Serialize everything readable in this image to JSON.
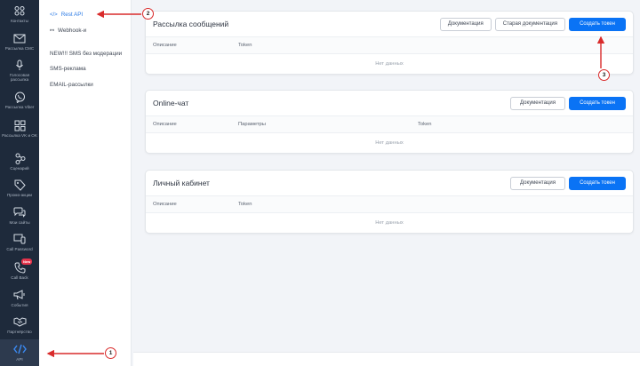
{
  "rail": {
    "items": [
      {
        "label": "Контакты",
        "icon": "contacts-icon"
      },
      {
        "label": "Рассылка СМС",
        "icon": "mail-icon"
      },
      {
        "label": "Голосовая рассылка",
        "icon": "microphone-icon"
      },
      {
        "label": "Рассылка Viber",
        "icon": "viber-icon"
      },
      {
        "label": "Рассылка VK и OK",
        "icon": "grid-icon"
      },
      {
        "label": "Сценарий",
        "icon": "scenario-icon"
      },
      {
        "label": "Промо-акции",
        "icon": "tag-icon"
      },
      {
        "label": "Мои сайты",
        "icon": "chat-icon"
      },
      {
        "label": "Call Password",
        "icon": "phone-screen-icon"
      },
      {
        "label": "Call Back",
        "icon": "callback-icon",
        "badge": "New"
      },
      {
        "label": "События",
        "icon": "megaphone-icon"
      },
      {
        "label": "Партнёрство",
        "icon": "handshake-icon"
      },
      {
        "label": "API",
        "icon": "code-icon"
      }
    ]
  },
  "submenu": {
    "items": [
      {
        "label": "Rest API",
        "icon": "</>"
      },
      {
        "label": "Webhook-и",
        "icon": "⚯"
      },
      {
        "label": "NEW!!! SMS без модерации",
        "icon": ""
      },
      {
        "label": "SMS-реклама",
        "icon": ""
      },
      {
        "label": "EMAIL-рассылки",
        "icon": ""
      }
    ]
  },
  "cards": [
    {
      "title": "Рассылка сообщений",
      "buttons": [
        "Документация",
        "Старая документация",
        "Создать токен"
      ],
      "columns": [
        "Описание",
        "Token"
      ],
      "empty": "Нет данных"
    },
    {
      "title": "Online-чат",
      "buttons": [
        "Документация",
        "Создать токен"
      ],
      "columns": [
        "Описание",
        "Параметры",
        "Token"
      ],
      "empty": "Нет данных"
    },
    {
      "title": "Личный кабинет",
      "buttons": [
        "Документация",
        "Создать токен"
      ],
      "columns": [
        "Описание",
        "Token"
      ],
      "empty": "Нет данных"
    }
  ],
  "annotations": [
    "1",
    "2",
    "3"
  ],
  "colors": {
    "accent": "#0a73f5",
    "rail": "#1e2a3b",
    "annotation": "#d92b2b"
  }
}
